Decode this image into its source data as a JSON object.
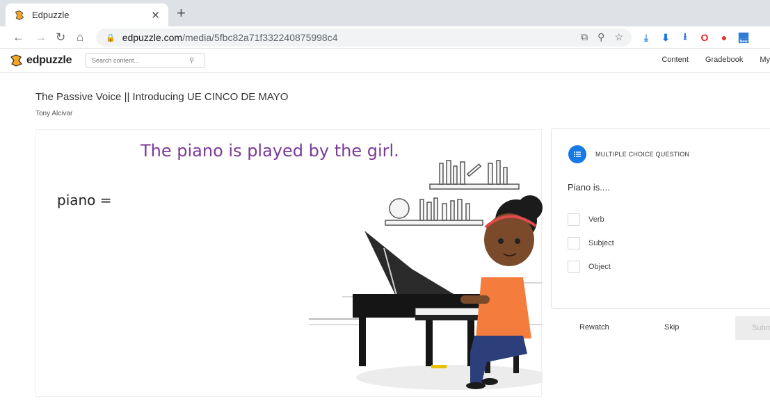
{
  "browser": {
    "tab_title": "Edpuzzle",
    "tab_close": "✕",
    "new_tab": "+",
    "url_host": "edpuzzle.com",
    "url_path": "/media/5fbc82a71f332240875998c4",
    "ext_new_label": "New"
  },
  "header": {
    "logo_text": "edpuzzle",
    "search_placeholder": "Search content...",
    "nav": [
      "Content",
      "Gradebook",
      "My"
    ]
  },
  "video": {
    "title": "The Passive Voice || Introducing UE CINCO DE MAYO",
    "author": "Tony Alcivar",
    "caption": "The piano is played by the girl.",
    "equation": "piano ="
  },
  "question": {
    "type": "MULTIPLE CHOICE QUESTION",
    "text": "Piano is....",
    "options": [
      "Verb",
      "Subject",
      "Object"
    ]
  },
  "actions": {
    "rewatch": "Rewatch",
    "skip": "Skip",
    "submit": "Subm"
  },
  "colors": {
    "accent": "#1679e5",
    "caption": "#7b3a96",
    "girl_skin": "#7a4a2a",
    "shirt": "#f47c3c"
  }
}
